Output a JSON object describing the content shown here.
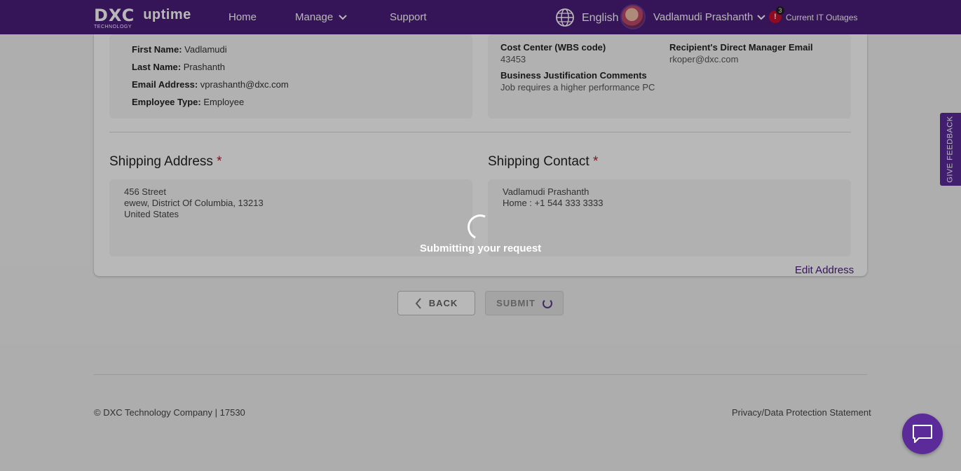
{
  "header": {
    "logo_text": "DXC",
    "logo_subtext": "TECHNOLOGY",
    "brand": "uptime",
    "nav": {
      "home": "Home",
      "manage": "Manage",
      "support": "Support"
    },
    "language": "English",
    "user_name": "Vadlamudi Prashanth",
    "alert_icon": "!",
    "alert_count": "3",
    "outages_label": "Current IT Outages",
    "bar_color": "#4a1c7a"
  },
  "recipient": {
    "first_name_label": "First Name:",
    "first_name": "Vadlamudi",
    "last_name_label": "Last Name:",
    "last_name": "Prashanth",
    "email_label": "Email Address:",
    "email": "vprashanth@dxc.com",
    "employee_type_label": "Employee Type:",
    "employee_type": "Employee"
  },
  "details": {
    "cost_center_label": "Cost Center (WBS code)",
    "cost_center": "43453",
    "manager_email_label": "Recipient's Direct Manager Email",
    "manager_email": "rkoper@dxc.com",
    "justification_label": "Business Justification Comments",
    "justification": "Job requires a higher performance PC"
  },
  "shipping_address": {
    "title": "Shipping Address",
    "required_mark": "*",
    "line1": "456 Street",
    "line2": "ewew, District Of Columbia, 13213",
    "line3": "United States"
  },
  "shipping_contact": {
    "title": "Shipping Contact",
    "required_mark": "*",
    "name": "Vadlamudi Prashanth",
    "phone": "Home : +1 544 333 3333"
  },
  "edit_address_label": "Edit Address",
  "buttons": {
    "back": "BACK",
    "submit": "SUBMIT"
  },
  "overlay": {
    "message": "Submitting your request"
  },
  "footer": {
    "copyright": "© DXC Technology Company | 17530",
    "privacy": "Privacy/Data Protection Statement"
  },
  "feedback_label": "GIVE FEEDBACK",
  "accent_color": "#5b2c99"
}
